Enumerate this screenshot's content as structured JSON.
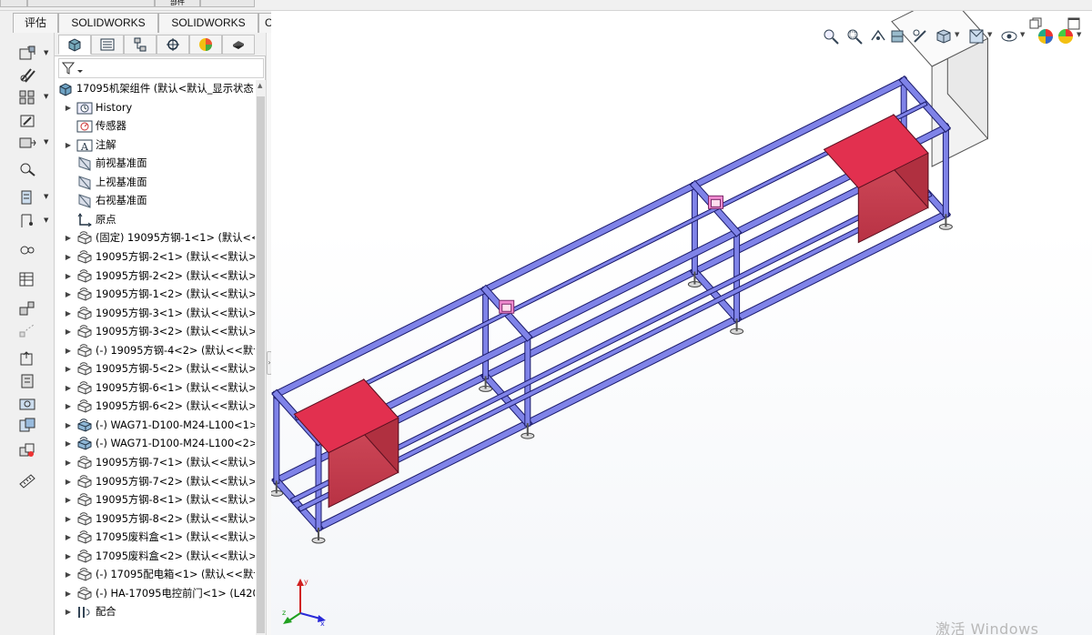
{
  "command_tabs": [
    {
      "label": "评估"
    },
    {
      "label": "SOLIDWORKS 插件"
    },
    {
      "label": "SOLIDWORKS MBD"
    },
    {
      "label": "CircuitWorks"
    }
  ],
  "top_strip_fragment": "部件",
  "feature_manager": {
    "tabs": [
      {
        "icon": "feature-manager-icon"
      },
      {
        "icon": "property-manager-icon"
      },
      {
        "icon": "configuration-manager-icon"
      },
      {
        "icon": "dimxpert-icon"
      },
      {
        "icon": "display-manager-icon"
      },
      {
        "icon": "cam-icon"
      }
    ],
    "filter_icon": "filter-icon",
    "root": "17095机架组件  (默认<默认_显示状态",
    "items": [
      {
        "label": "History",
        "icon": "history-icon",
        "expandable": true
      },
      {
        "label": "传感器",
        "icon": "sensor-icon",
        "expandable": false
      },
      {
        "label": "注解",
        "icon": "annotation-icon",
        "expandable": true
      },
      {
        "label": "前视基准面",
        "icon": "plane-icon",
        "expandable": false
      },
      {
        "label": "上视基准面",
        "icon": "plane-icon",
        "expandable": false
      },
      {
        "label": "右视基准面",
        "icon": "plane-icon",
        "expandable": false
      },
      {
        "label": "原点",
        "icon": "origin-icon",
        "expandable": false
      },
      {
        "label": "(固定) 19095方钢-1<1> (默认<<",
        "icon": "part-icon",
        "expandable": true
      },
      {
        "label": "19095方钢-2<1> (默认<<默认>_",
        "icon": "part-icon",
        "expandable": true
      },
      {
        "label": "19095方钢-2<2> (默认<<默认>_",
        "icon": "part-icon",
        "expandable": true
      },
      {
        "label": "19095方钢-1<2> (默认<<默认>_",
        "icon": "part-icon",
        "expandable": true
      },
      {
        "label": "19095方钢-3<1> (默认<<默认>_",
        "icon": "part-icon",
        "expandable": true
      },
      {
        "label": "19095方钢-3<2> (默认<<默认>_",
        "icon": "part-icon",
        "expandable": true
      },
      {
        "label": "(-) 19095方钢-4<2> (默认<<默认",
        "icon": "part-icon",
        "expandable": true
      },
      {
        "label": "19095方钢-5<2> (默认<<默认>_",
        "icon": "part-icon",
        "expandable": true
      },
      {
        "label": "19095方钢-6<1> (默认<<默认>_",
        "icon": "part-icon",
        "expandable": true
      },
      {
        "label": "19095方钢-6<2> (默认<<默认>_",
        "icon": "part-icon",
        "expandable": true
      },
      {
        "label": "(-) WAG71-D100-M24-L100<1>",
        "icon": "assembly-icon",
        "expandable": true
      },
      {
        "label": "(-) WAG71-D100-M24-L100<2>",
        "icon": "assembly-icon",
        "expandable": true
      },
      {
        "label": "19095方钢-7<1> (默认<<默认>_",
        "icon": "part-icon",
        "expandable": true
      },
      {
        "label": "19095方钢-7<2> (默认<<默认>_",
        "icon": "part-icon",
        "expandable": true
      },
      {
        "label": "19095方钢-8<1> (默认<<默认>_",
        "icon": "part-icon",
        "expandable": true
      },
      {
        "label": "19095方钢-8<2> (默认<<默认>_",
        "icon": "part-icon",
        "expandable": true
      },
      {
        "label": "17095废料盒<1> (默认<<默认>_",
        "icon": "part-icon",
        "expandable": true
      },
      {
        "label": "17095废料盒<2> (默认<<默认>_",
        "icon": "part-icon",
        "expandable": true
      },
      {
        "label": "(-) 17095配电箱<1> (默认<<默认",
        "icon": "part-icon",
        "expandable": true
      },
      {
        "label": "(-) HA-17095电控前门<1> (L420",
        "icon": "part-icon",
        "expandable": true
      },
      {
        "label": "配合",
        "icon": "mates-icon",
        "expandable": true
      }
    ]
  },
  "left_toolbar_icons": [
    "insert-components-icon",
    "mate-icon",
    "linear-pattern-icon",
    "smart-fasteners-icon",
    "move-component-icon",
    "show-hidden-icon",
    "assembly-features-icon",
    "reference-geometry-icon",
    "new-motion-study-icon",
    "bill-of-materials-icon",
    "exploded-view-icon",
    "explode-line-icon",
    "instant3d-icon",
    "update-speedpak-icon",
    "take-snapshot-icon",
    "large-assembly-icon",
    "interference-detection-icon",
    "clearance-verification-icon",
    "measure-icon"
  ],
  "heads_up_toolbar": [
    "zoom-to-fit-icon",
    "zoom-to-area-icon",
    "previous-view-icon",
    "section-view-icon",
    "dynamic-annotation-icon",
    "view-orientation-icon",
    "display-style-icon",
    "hide-show-icon",
    "edit-appearance-icon",
    "apply-scene-icon",
    "view-settings-icon"
  ],
  "watermark": "激活 Windows",
  "triad_axes": {
    "x": "x",
    "y": "y",
    "z": "z"
  }
}
